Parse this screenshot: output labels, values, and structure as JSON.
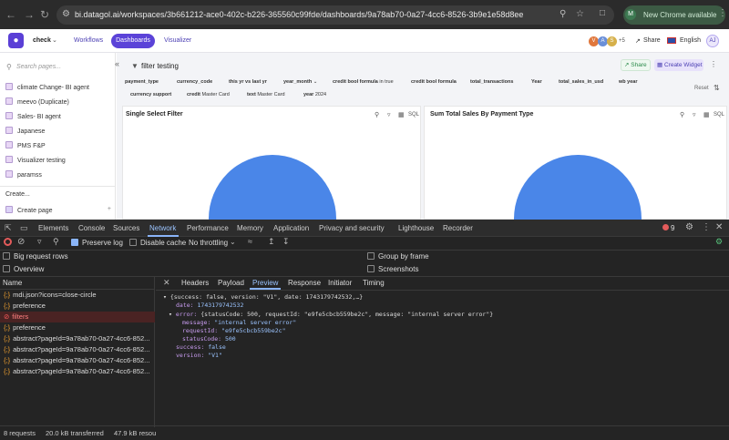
{
  "browser": {
    "url": "bi.datagol.ai/workspaces/3b661212-ace0-402c-b226-365560c99fde/dashboards/9a78ab70-0a27-4cc6-8526-3b9e1e58d8ee",
    "update_label": "New Chrome available",
    "profile_initial": "M"
  },
  "app": {
    "workspace": "check",
    "nav": {
      "workflows": "Workflows",
      "dashboards": "Dashboards",
      "visualizer": "Visualizer"
    },
    "avatars": [
      "V",
      "A",
      "S"
    ],
    "avatar_more": "+5",
    "share": "Share",
    "language": "English",
    "user_initials": "AJ"
  },
  "sidebar": {
    "search_placeholder": "Search pages...",
    "items": [
      "climate Change- BI agent",
      "meevo (Duplicate)",
      "Sales- BI agent",
      "Japanese",
      "PMS F&P",
      "Visualizer testing",
      "paramss"
    ],
    "create_label": "Create...",
    "create_page": "Create page"
  },
  "dashboard": {
    "title": "filter testing",
    "share": "Share",
    "create_widget": "Create Widget",
    "reset": "Reset",
    "filters_row1": [
      {
        "name": "payment_type",
        "value": ""
      },
      {
        "name": "currency_code",
        "value": ""
      },
      {
        "name": "this yr vs last yr",
        "value": ""
      },
      {
        "name": "year_month",
        "value": ""
      },
      {
        "name": "credit bool formula",
        "value": "in true"
      },
      {
        "name": "credit bool formula",
        "value": ""
      },
      {
        "name": "total_transactions",
        "value": ""
      },
      {
        "name": "Year",
        "value": ""
      },
      {
        "name": "total_sales_in_usd",
        "value": ""
      },
      {
        "name": "wb year",
        "value": ""
      }
    ],
    "filters_row2": [
      {
        "name": "currency support",
        "value": ""
      },
      {
        "name": "credit",
        "value": "Master Card"
      },
      {
        "name": "text",
        "value": "Master Card"
      },
      {
        "name": "year",
        "value": "2024"
      }
    ],
    "widgets": [
      {
        "title": "Single Select Filter",
        "sql": "SQL"
      },
      {
        "title": "Sum Total Sales By Payment Type",
        "sql": "SQL"
      }
    ],
    "pie_color": "#4a86e8"
  },
  "devtools": {
    "tabs": [
      "Elements",
      "Console",
      "Sources",
      "Network",
      "Performance",
      "Memory",
      "Application",
      "Privacy and security",
      "Lighthouse",
      "Recorder"
    ],
    "error_count": "9",
    "preserve_log": "Preserve log",
    "disable_cache": "Disable cache",
    "throttling": "No throttling",
    "big_rows": "Big request rows",
    "group_by_frame": "Group by frame",
    "overview": "Overview",
    "screenshots": "Screenshots",
    "name_header": "Name",
    "requests": [
      {
        "name": "mdi.json?icons=close-circle",
        "status": "ok"
      },
      {
        "name": "preference",
        "status": "ok"
      },
      {
        "name": "filters",
        "status": "error"
      },
      {
        "name": "preference",
        "status": "ok"
      },
      {
        "name": "abstract?pageId=9a78ab70-0a27-4cc6-852...",
        "status": "ok"
      },
      {
        "name": "abstract?pageId=9a78ab70-0a27-4cc6-852...",
        "status": "ok"
      },
      {
        "name": "abstract?pageId=9a78ab70-0a27-4cc6-852...",
        "status": "ok"
      },
      {
        "name": "abstract?pageId=9a78ab70-0a27-4cc6-852...",
        "status": "ok"
      }
    ],
    "detail_tabs": [
      "Headers",
      "Payload",
      "Preview",
      "Response",
      "Initiator",
      "Timing"
    ],
    "preview": {
      "summary": "{success: false, version: \"V1\", date: 1743179742532,…}",
      "date_key": "date:",
      "date_val": "1743179742532",
      "error_key": "error:",
      "error_summary": "{statusCode: 500, requestId: \"e9fe5cbcb559be2c\", message: \"internal server error\"}",
      "message_key": "message:",
      "message_val": "\"internal server error\"",
      "requestId_key": "requestId:",
      "requestId_val": "\"e9fe5cbcb559be2c\"",
      "statusCode_key": "statusCode:",
      "statusCode_val": "500",
      "success_key": "success:",
      "success_val": "false",
      "version_key": "version:",
      "version_val": "\"V1\""
    },
    "footer": {
      "requests": "8 requests",
      "transferred": "20.0 kB transferred",
      "resources": "47.9 kB resou"
    }
  }
}
